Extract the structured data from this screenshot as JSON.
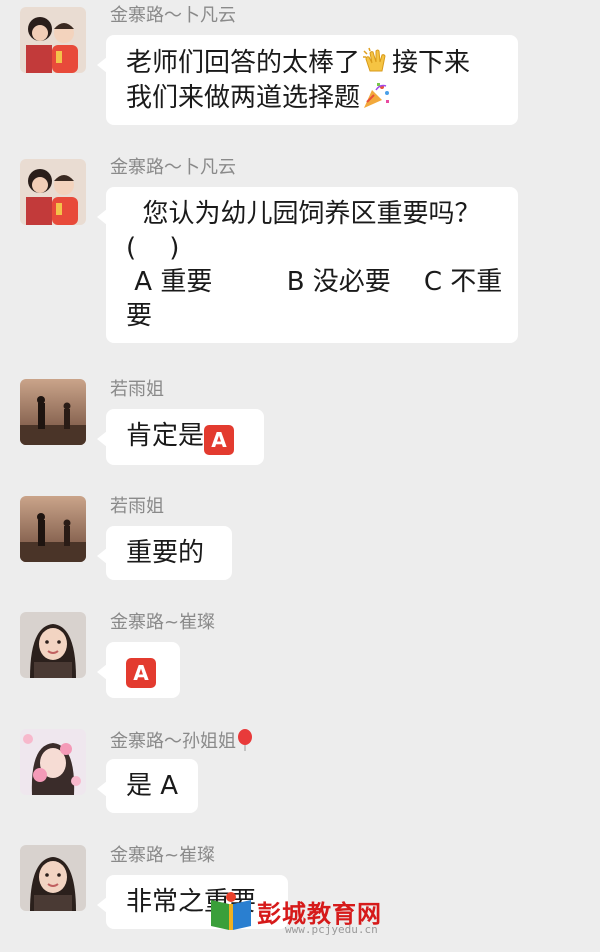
{
  "messages": [
    {
      "sender": "金寨路～卜凡云",
      "avatar": "mother-and-child-avatar",
      "lines": [
        {
          "parts": [
            "老师们回答的太棒了",
            {
              "emoji": "clapping-hands-icon"
            },
            "接下来"
          ]
        },
        {
          "parts": [
            "我们来做两道选择题",
            {
              "emoji": "party-popper-icon"
            }
          ]
        }
      ]
    },
    {
      "sender": "金寨路～卜凡云",
      "avatar": "mother-and-child-avatar",
      "lines": [
        {
          "parts": [
            "  您认为幼儿园饲养区重要吗？"
          ]
        },
        {
          "parts": [
            "(    )"
          ]
        },
        {
          "parts": [
            " A 重要         B 没必要    C 不重"
          ]
        },
        {
          "parts": [
            "要"
          ]
        }
      ]
    },
    {
      "sender": "若雨姐",
      "avatar": "sunset-landscape-avatar",
      "lines": [
        {
          "parts": [
            "肯定是",
            {
              "badge": "A"
            }
          ]
        }
      ]
    },
    {
      "sender": "若雨姐",
      "avatar": "sunset-landscape-avatar",
      "lines": [
        {
          "parts": [
            "重要的"
          ]
        }
      ]
    },
    {
      "sender": "金寨路~崔璨",
      "avatar": "girl-portrait-avatar",
      "lines": [
        {
          "parts": [
            {
              "badge": "A"
            }
          ]
        }
      ]
    },
    {
      "sender": "金寨路～孙姐姐",
      "sender_suffix": "balloon-icon",
      "avatar": "girl-with-stickers-avatar",
      "lines": [
        {
          "parts": [
            "是 A"
          ]
        }
      ]
    },
    {
      "sender": "金寨路~崔璨",
      "avatar": "girl-portrait-avatar",
      "lines": [
        {
          "parts": [
            "非常之重要"
          ]
        }
      ]
    }
  ],
  "watermark": {
    "title": "彭城教育网",
    "url": "www.pcjyedu.cn"
  },
  "colors": {
    "background": "#ededed",
    "bubble": "#ffffff",
    "sender": "#8a8a8a",
    "badge": "#e33b2f",
    "watermark": "#d61a1a"
  }
}
